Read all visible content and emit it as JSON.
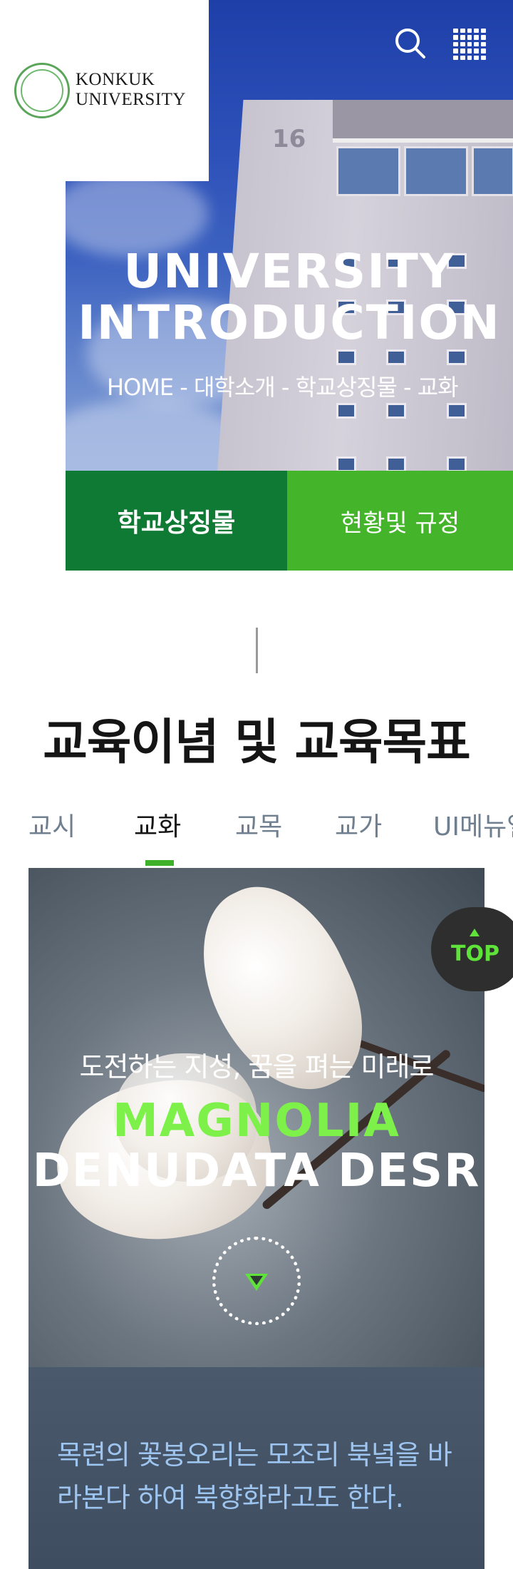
{
  "header": {
    "logo_line1": "KONKUK",
    "logo_line2": "UNIVERSITY"
  },
  "hero": {
    "title_line1": "UNIVERSITY",
    "title_line2": "INTRODUCTION",
    "building_number": "16",
    "breadcrumb": "HOME - 대학소개 - 학교상징물 - 교화",
    "tabs": [
      {
        "label": "학교상징물",
        "active": true
      },
      {
        "label": "현황및 규정",
        "active": false
      }
    ]
  },
  "section": {
    "title": "교육이념 및 교육목표",
    "sub_tabs": [
      {
        "label": "교시",
        "active": false
      },
      {
        "label": "교화",
        "active": true
      },
      {
        "label": "교목",
        "active": false
      },
      {
        "label": "교가",
        "active": false
      },
      {
        "label": "UI메뉴얼",
        "active": false
      }
    ]
  },
  "feature": {
    "kicker": "도전하는 지성, 꿈을 펴는 미래로",
    "title_line1": "MAGNOLIA",
    "title_line2": "DENUDATA DESR",
    "caption": "목련의 꽃봉오리는 모조리 북녘을 바라본다 하여 북향화라고도 한다."
  },
  "top_button": {
    "label": "TOP"
  },
  "colors": {
    "primary_green": "#0e7a34",
    "secondary_green": "#44b52a",
    "accent_green": "#7df04a",
    "caption_blue": "#9ec4f0"
  },
  "icons": [
    "search-icon",
    "apps-grid-icon",
    "university-seal-icon",
    "play-icon",
    "arrow-up-icon"
  ]
}
